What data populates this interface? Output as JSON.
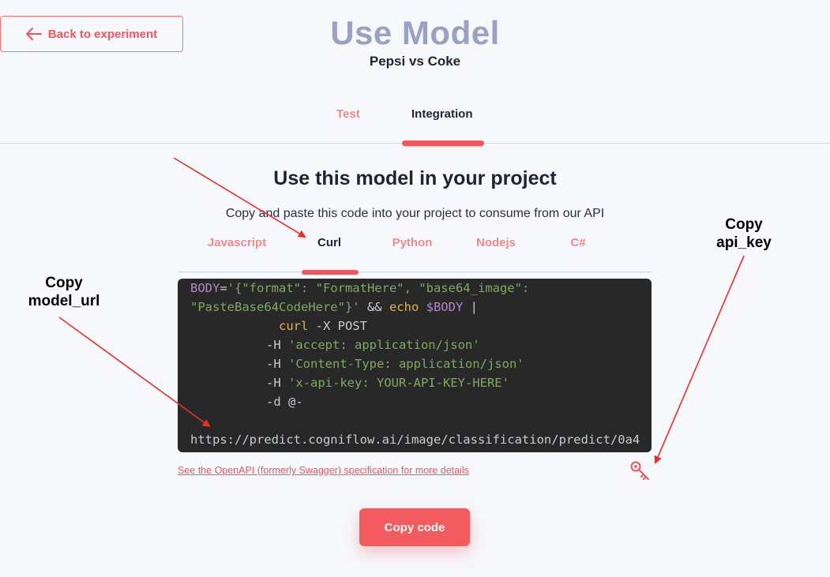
{
  "header": {
    "back_label": "Back to experiment",
    "title": "Use Model",
    "subtitle": "Pepsi vs Coke"
  },
  "main_tabs": [
    {
      "label": "Test",
      "active": false
    },
    {
      "label": "Integration",
      "active": true
    }
  ],
  "section": {
    "title": "Use this model in your project",
    "description": "Copy and paste this code into your project to consume from our API"
  },
  "lang_tabs": [
    {
      "label": "Javascript",
      "active": false
    },
    {
      "label": "Curl",
      "active": true
    },
    {
      "label": "Python",
      "active": false
    },
    {
      "label": "Nodejs",
      "active": false
    },
    {
      "label": "C#",
      "active": false
    }
  ],
  "code": {
    "line1_var": "BODY",
    "line1_eq": "=",
    "line1_str": "'{\"format\": \"FormatHere\", \"base64_image\":",
    "line2_str": "\"PasteBase64CodeHere\"}'",
    "line2_op": " && ",
    "line2_cmd": "echo",
    "line2_ref": " $BODY",
    "line2_pipe": " |",
    "line3_indent": "            ",
    "line3_cmd": "curl",
    "line3_rest": " -X POST",
    "line4_flag": "-H ",
    "line4_str": "'accept: application/json'",
    "line5_flag": "-H ",
    "line5_str": "'Content-Type: application/json'",
    "line6_flag": "-H ",
    "line6_str": "'x-api-key: YOUR-API-KEY-HERE'",
    "line7": "-d @-",
    "line8": "",
    "line9": "https://predict.cogniflow.ai/image/classification/predict/0a4"
  },
  "spec_link": "See the OpenAPI (formerly Swagger) specification for more details",
  "copy_button": "Copy code",
  "annotations": {
    "model_url": "Copy\nmodel_url",
    "api_key": "Copy\napi_key"
  },
  "colors": {
    "accent": "#f25c5f",
    "title": "#9aa1c2",
    "code_bg": "#282828",
    "arrow": "#e8302a"
  },
  "icons": {
    "back": "arrow-left-icon",
    "key": "key-icon"
  }
}
